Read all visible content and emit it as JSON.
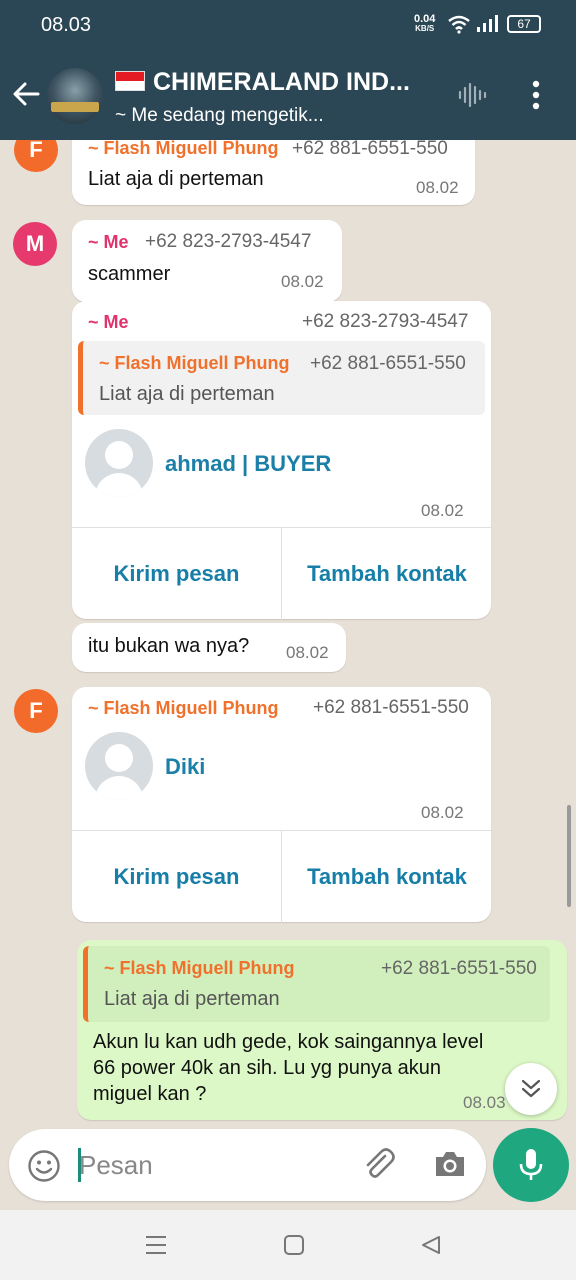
{
  "status_bar": {
    "time": "08.03",
    "net_speed": "0.04",
    "net_unit": "KB/S",
    "battery": "67"
  },
  "header": {
    "title": "CHIMERALAND IND...",
    "subtitle": "~ Me sedang mengetik...",
    "avatar_logo_text": "CHIMERALAND"
  },
  "messages": [
    {
      "sender": "~ Flash Miguell Phung",
      "phone": "+62 881-6551-550",
      "text": "Liat aja di perteman",
      "time": "08.02",
      "avatar": "F"
    },
    {
      "sender": "~ Me",
      "phone": "+62 823-2793-4547",
      "text": "scammer",
      "time": "08.02",
      "avatar": "M"
    },
    {
      "sender": "~ Me",
      "phone": "+62 823-2793-4547",
      "quote": {
        "sender": "~ Flash Miguell Phung",
        "phone": "+62 881-6551-550",
        "text": "Liat aja di perteman"
      },
      "contact": {
        "name": "ahmad | BUYER"
      },
      "time": "08.02",
      "buttons": [
        "Kirim pesan",
        "Tambah kontak"
      ]
    },
    {
      "text": "itu bukan wa nya?",
      "time": "08.02"
    },
    {
      "sender": "~ Flash Miguell Phung",
      "phone": "+62 881-6551-550",
      "avatar": "F",
      "contact": {
        "name": "Diki"
      },
      "time": "08.02",
      "buttons": [
        "Kirim pesan",
        "Tambah kontak"
      ]
    },
    {
      "outgoing": true,
      "quote": {
        "sender": "~ Flash Miguell Phung",
        "phone": "+62 881-6551-550",
        "text": "Liat aja di perteman"
      },
      "lines": [
        "Akun lu kan udh gede, kok saingannya level",
        "66 power 40k an sih. Lu yg punya akun",
        "miguel kan ?"
      ],
      "time": "08.03"
    }
  ],
  "input": {
    "placeholder": "Pesan"
  },
  "colors": {
    "header": "#2b4654",
    "chat_bg": "#e7e0d6",
    "outgoing": "#dcf8c6",
    "accent_green": "#1fa77f",
    "sender_orange": "#f0712c",
    "sender_pink": "#e0336d",
    "avatar_f": "#f26b2b",
    "avatar_m": "#e6396d",
    "contact_link": "#1c7fa8"
  },
  "icons": [
    "back-arrow-icon",
    "voice-call-icon",
    "more-vert-icon",
    "scroll-down-icon",
    "emoji-icon",
    "attach-icon",
    "camera-icon",
    "mic-icon",
    "nav-menu-icon",
    "nav-home-icon",
    "nav-back-icon",
    "wifi-icon",
    "signal-icon"
  ]
}
